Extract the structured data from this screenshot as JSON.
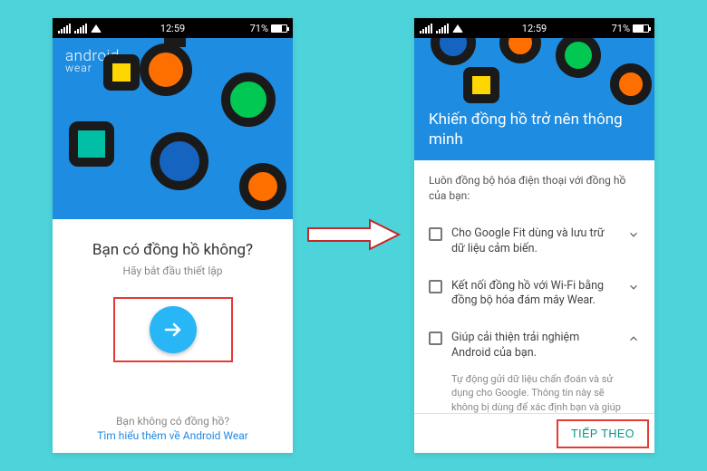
{
  "statusbar": {
    "time": "12:59",
    "battery": "71%"
  },
  "brand": {
    "line1": "android",
    "line2": "wear"
  },
  "left": {
    "question": "Bạn có đồng hồ không?",
    "subtitle": "Hãy bắt đầu thiết lập",
    "no_watch": "Bạn không có đồng hồ?",
    "learn_more": "Tìm hiểu thêm về Android Wear"
  },
  "right": {
    "title": "Khiến đồng hồ trở nên thông minh",
    "intro": "Luôn đồng bộ hóa điện thoại với đồng hồ của bạn:",
    "opt1": "Cho Google Fit dùng và lưu trữ dữ liệu cảm biến.",
    "opt2": "Kết nối đồng hồ với Wi-Fi bằng đồng bộ hóa đám mây Wear.",
    "opt3": "Giúp cải thiện trải nghiệm Android của bạn.",
    "opt3_desc": "Tự động gửi dữ liệu chẩn đoán và sử dụng cho Google. Thông tin này sẽ không bị dùng để xác định bạn và giúp",
    "next": "TIẾP THEO"
  }
}
